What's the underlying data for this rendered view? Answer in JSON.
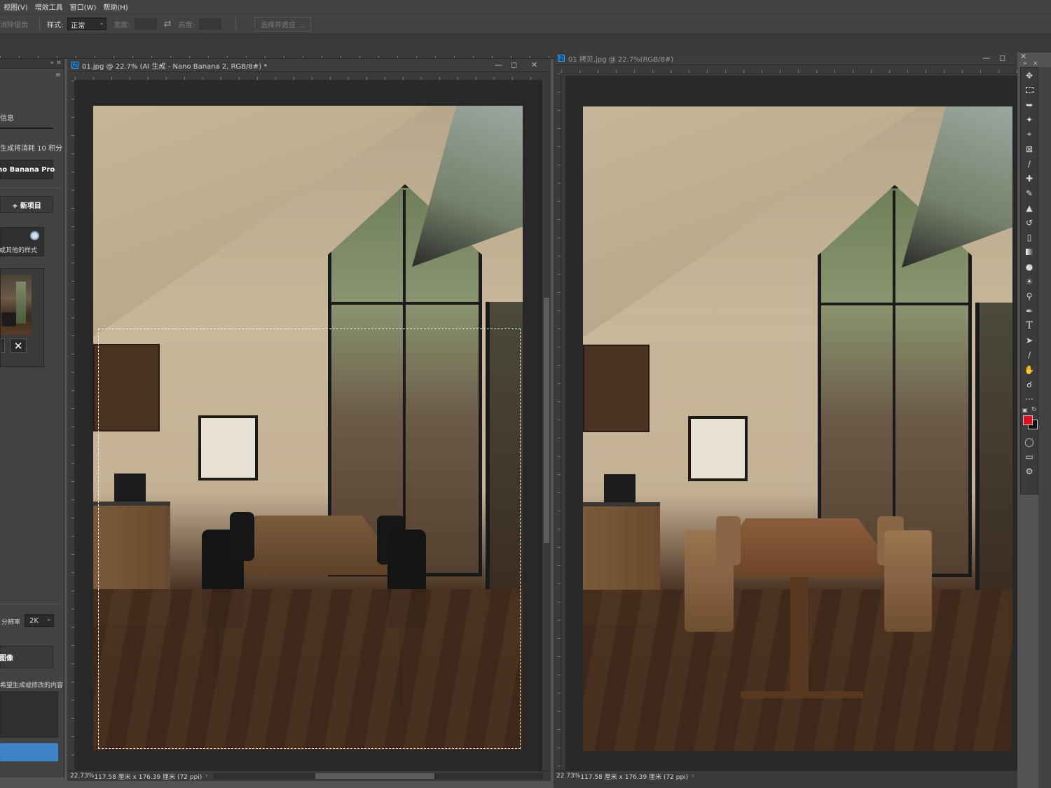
{
  "menubar": {
    "items": [
      "视图(V)",
      "增效工具",
      "窗口(W)",
      "帮助(H)"
    ]
  },
  "optionsbar": {
    "feather_label": "消除锯齿",
    "style_label": "样式:",
    "style_value": "正常",
    "width_label": "宽度:",
    "height_label": "高度:",
    "mask_button": "选择并遮住 ..."
  },
  "leftpanel": {
    "info_label": "信息",
    "credits_text": "生成将消耗 10 积分",
    "model_name": "Nano Banana Pro",
    "new_project": "+ 新项目",
    "style_hint": "或其他的样式",
    "resolution_label": "分辨率",
    "resolution_value": "2K",
    "generate_label": "图像",
    "prompt_hint": "希望生成或修改的内容"
  },
  "doc_left": {
    "title": "01.jpg @ 22.7% (AI 生成 - Nano Banana 2, RGB/8#) *",
    "status": "22.73%",
    "status_dims": "117.58 厘米 x 176.39 厘米 (72 ppi)"
  },
  "doc_right": {
    "title": "01 拷贝.jpg @ 22.7%(RGB/8#)",
    "status": "22.73%",
    "status_dims": "117.58 厘米 x 176.39 厘米 (72 ppi)"
  },
  "colors": {
    "foreground": "#e0101e",
    "background": "#111111",
    "accent": "#3d84c6"
  },
  "tools": [
    "move-icon",
    "marquee-icon",
    "lasso-icon",
    "magic-wand-icon",
    "crop-icon",
    "frame-icon",
    "eyedropper-icon",
    "healing-icon",
    "brush-icon",
    "stamp-icon",
    "history-brush-icon",
    "eraser-icon",
    "gradient-icon",
    "blur-icon",
    "dodge-icon",
    "burn-icon",
    "pen-icon",
    "type-icon",
    "path-select-icon",
    "line-icon",
    "hand-icon",
    "zoom-icon",
    "more-icon"
  ]
}
